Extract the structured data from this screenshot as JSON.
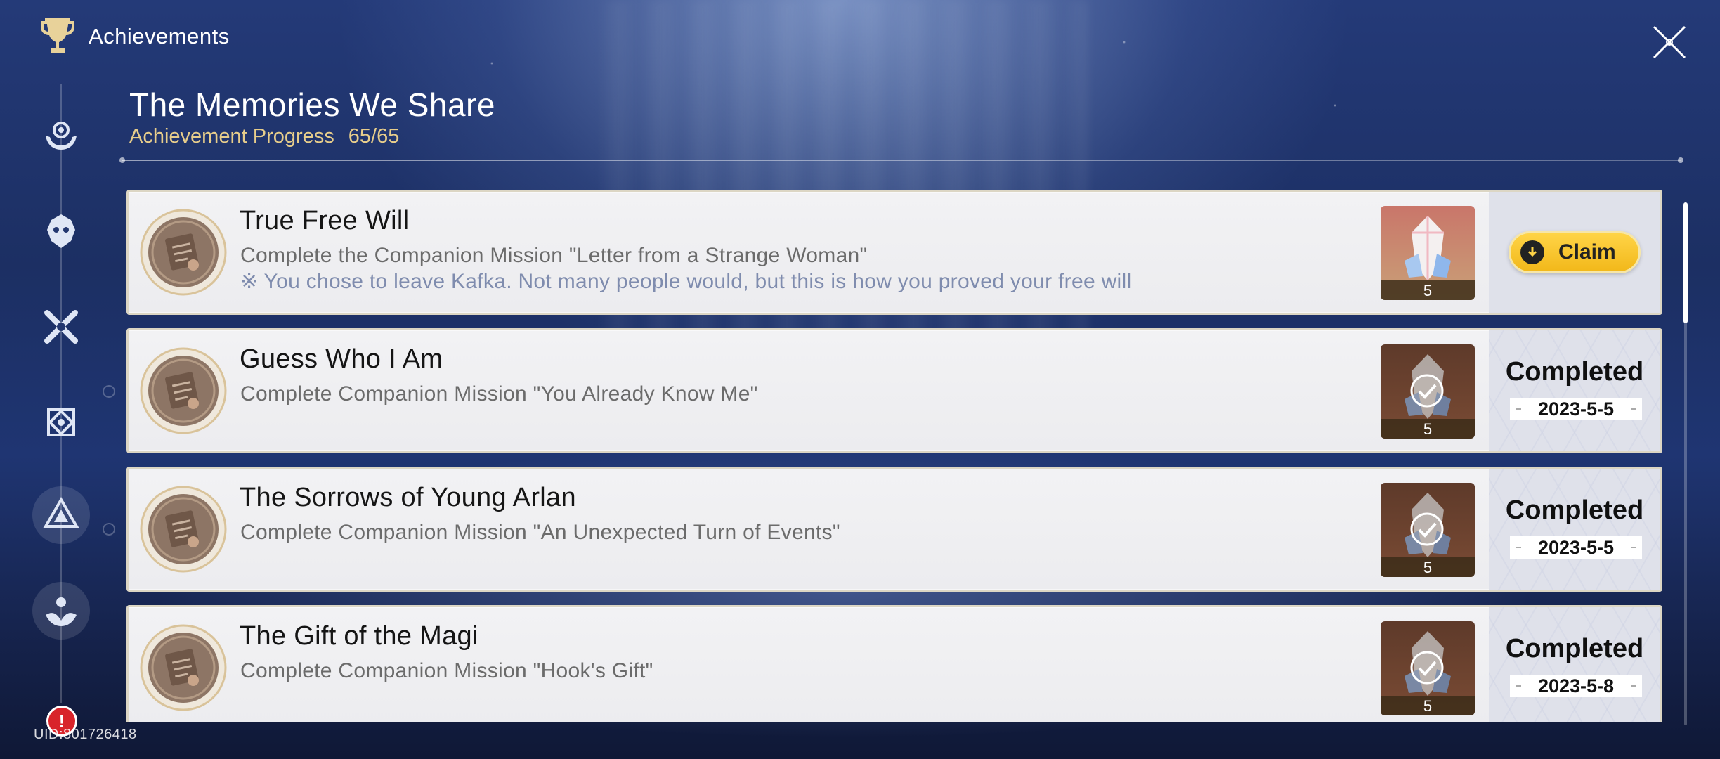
{
  "header": {
    "title": "Achievements"
  },
  "page": {
    "title": "The Memories We Share",
    "progress_label": "Achievement Progress",
    "progress_value": "65/65"
  },
  "sidebar": {
    "items": [
      {
        "icon": "hands-gear-icon"
      },
      {
        "icon": "mask-emblem-icon"
      },
      {
        "icon": "crossed-weapons-icon"
      },
      {
        "icon": "diamond-emblem-icon"
      },
      {
        "icon": "triangle-emblem-icon"
      },
      {
        "icon": "lotus-emblem-icon"
      }
    ],
    "alert_badge": "!",
    "uid": "UID:801726418"
  },
  "achievements": [
    {
      "name": "True Free Will",
      "description": "Complete the Companion Mission \"Letter from a Strange Woman\"",
      "lore": "※ You chose to leave Kafka. Not many people would, but this is how you proved your free will",
      "reward_qty": "5",
      "status": "claim",
      "claim_label": "Claim"
    },
    {
      "name": "Guess Who I Am",
      "description": "Complete Companion Mission \"You Already Know Me\"",
      "reward_qty": "5",
      "status": "completed",
      "status_label": "Completed",
      "date": "2023-5-5"
    },
    {
      "name": "The Sorrows of Young Arlan",
      "description": "Complete Companion Mission \"An Unexpected Turn of Events\"",
      "reward_qty": "5",
      "status": "completed",
      "status_label": "Completed",
      "date": "2023-5-5"
    },
    {
      "name": "The Gift of the Magi",
      "description": "Complete Companion Mission \"Hook's Gift\"",
      "reward_qty": "5",
      "status": "completed",
      "status_label": "Completed",
      "date": "2023-5-8"
    }
  ],
  "colors": {
    "accent_gold": "#e7cd8b",
    "claim_yellow": "#f2b81a",
    "card_bg": "#f0f0f2",
    "alert_red": "#d8242a"
  }
}
